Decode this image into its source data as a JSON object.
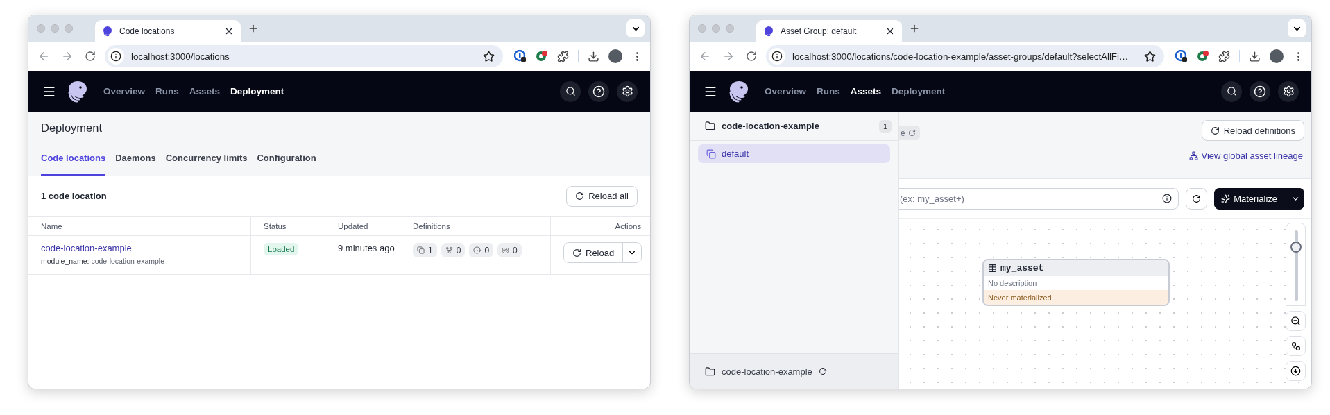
{
  "windows": [
    {
      "kind": "deployment",
      "tab": {
        "title": "Code locations"
      },
      "address": "localhost:3000/locations",
      "nav": [
        {
          "label": "Overview",
          "selected": false
        },
        {
          "label": "Runs",
          "selected": false
        },
        {
          "label": "Assets",
          "selected": false
        },
        {
          "label": "Deployment",
          "selected": true
        }
      ],
      "page": {
        "title": "Deployment",
        "tabs": [
          {
            "label": "Code locations",
            "selected": true
          },
          {
            "label": "Daemons",
            "selected": false
          },
          {
            "label": "Concurrency limits",
            "selected": false
          },
          {
            "label": "Configuration",
            "selected": false
          }
        ],
        "count": "1 code location",
        "reload_all": "Reload all",
        "columns": [
          "Name",
          "Status",
          "Updated",
          "Definitions",
          "Actions"
        ],
        "rows": [
          {
            "name": "code-location-example",
            "meta": "**module_name:** code-location-example",
            "status": "Loaded",
            "updated": "9 minutes ago",
            "definitions": [
              {
                "kind": "assets",
                "count": "1"
              },
              {
                "kind": "jobs",
                "count": "0"
              },
              {
                "kind": "schedules",
                "count": "0"
              },
              {
                "kind": "sensors",
                "count": "0"
              }
            ],
            "action": "Reload"
          }
        ]
      }
    },
    {
      "kind": "asset_group",
      "tab": {
        "title": "Asset Group: default"
      },
      "address": "localhost:3000/locations/code-location-example/asset-groups/default?selectAllFi…",
      "nav": [
        {
          "label": "Overview",
          "selected": false
        },
        {
          "label": "Runs",
          "selected": false
        },
        {
          "label": "Assets",
          "selected": true
        },
        {
          "label": "Deployment",
          "selected": false
        }
      ],
      "sidebar": {
        "location": "code-location-example",
        "count": "1",
        "groups": [
          {
            "label": "default",
            "selected": true
          }
        ],
        "footer": "code-location-example"
      },
      "main": {
        "badge_fragment": "e",
        "reload": "Reload definitions",
        "lineage_link": "View global asset lineage",
        "search_placeholder": "(ex: my_asset+)",
        "materialize": "Materialize",
        "zoom": {
          "level": 0.8
        },
        "node": {
          "name": "my_asset",
          "description": "No description",
          "status": "Never materialized"
        }
      }
    }
  ]
}
